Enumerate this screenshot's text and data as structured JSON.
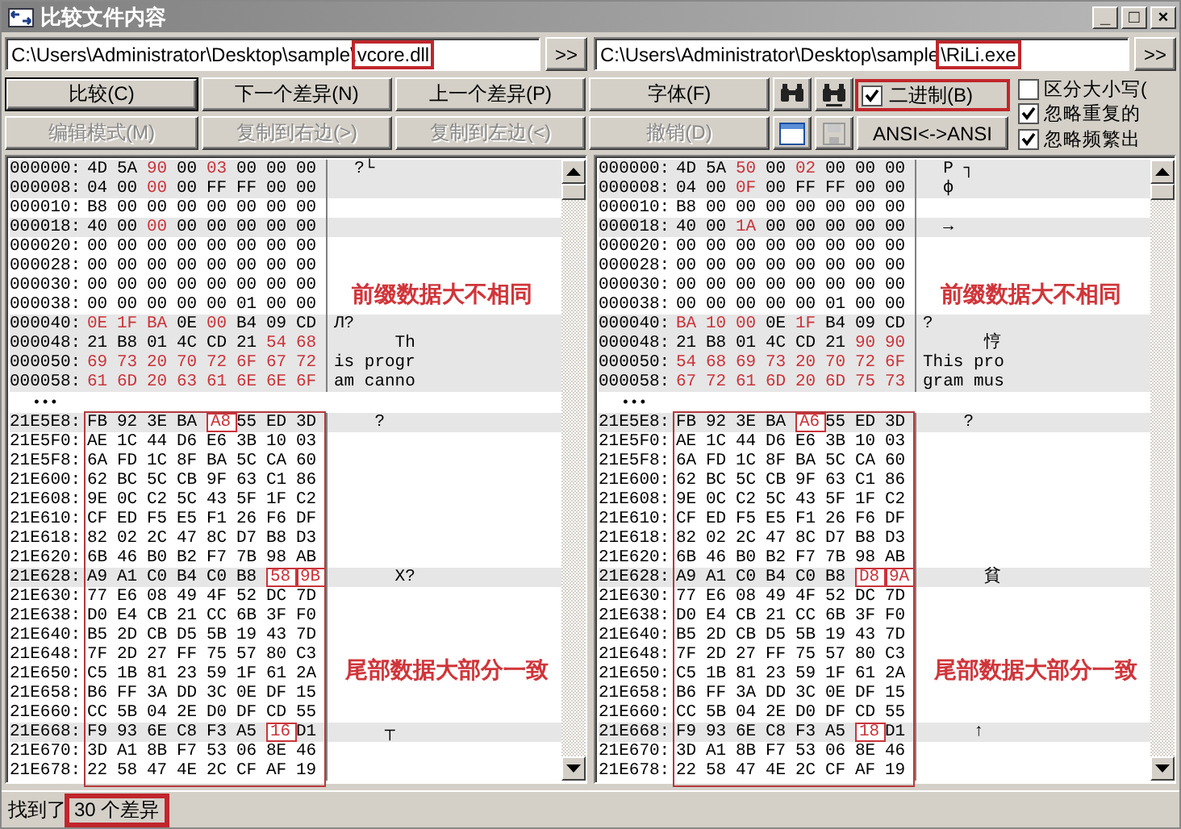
{
  "window": {
    "title": "比较文件内容",
    "controls": [
      "_",
      "□",
      "×"
    ]
  },
  "panes": [
    {
      "path": {
        "prefix": "C:\\Users\\Administrator\\Desktop\\sample\\",
        "file": "vcore.dll",
        "highlighted": true
      },
      "browse_button": ">>",
      "head_rows": [
        {
          "addr": "000000:",
          "bytes": [
            "4D",
            "5A",
            "90",
            "00",
            "03",
            "00",
            "00",
            "00"
          ],
          "diff": [
            false,
            false,
            true,
            false,
            true,
            false,
            false,
            false
          ],
          "ascii": "  ?└"
        },
        {
          "addr": "000008:",
          "bytes": [
            "04",
            "00",
            "00",
            "00",
            "FF",
            "FF",
            "00",
            "00"
          ],
          "diff": [
            false,
            false,
            true,
            false,
            false,
            false,
            false,
            false
          ],
          "ascii": ""
        },
        {
          "addr": "000010:",
          "bytes": [
            "B8",
            "00",
            "00",
            "00",
            "00",
            "00",
            "00",
            "00"
          ],
          "diff": [
            false,
            false,
            false,
            false,
            false,
            false,
            false,
            false
          ],
          "ascii": ""
        },
        {
          "addr": "000018:",
          "bytes": [
            "40",
            "00",
            "00",
            "00",
            "00",
            "00",
            "00",
            "00"
          ],
          "diff": [
            false,
            false,
            true,
            false,
            false,
            false,
            false,
            false
          ],
          "ascii": ""
        },
        {
          "addr": "000020:",
          "bytes": [
            "00",
            "00",
            "00",
            "00",
            "00",
            "00",
            "00",
            "00"
          ],
          "diff": [
            false,
            false,
            false,
            false,
            false,
            false,
            false,
            false
          ],
          "ascii": ""
        },
        {
          "addr": "000028:",
          "bytes": [
            "00",
            "00",
            "00",
            "00",
            "00",
            "00",
            "00",
            "00"
          ],
          "diff": [
            false,
            false,
            false,
            false,
            false,
            false,
            false,
            false
          ],
          "ascii": ""
        },
        {
          "addr": "000030:",
          "bytes": [
            "00",
            "00",
            "00",
            "00",
            "00",
            "00",
            "00",
            "00"
          ],
          "diff": [
            false,
            false,
            false,
            false,
            false,
            false,
            false,
            false
          ],
          "ascii": ""
        },
        {
          "addr": "000038:",
          "bytes": [
            "00",
            "00",
            "00",
            "00",
            "00",
            "01",
            "00",
            "00"
          ],
          "diff": [
            false,
            false,
            false,
            false,
            false,
            false,
            false,
            false
          ],
          "ascii": ""
        },
        {
          "addr": "000040:",
          "bytes": [
            "0E",
            "1F",
            "BA",
            "0E",
            "00",
            "B4",
            "09",
            "CD"
          ],
          "diff": [
            true,
            true,
            true,
            false,
            true,
            false,
            false,
            false
          ],
          "ascii": "Л?"
        },
        {
          "addr": "000048:",
          "bytes": [
            "21",
            "B8",
            "01",
            "4C",
            "CD",
            "21",
            "54",
            "68"
          ],
          "diff": [
            false,
            false,
            false,
            false,
            false,
            false,
            true,
            true
          ],
          "ascii": "      Th"
        },
        {
          "addr": "000050:",
          "bytes": [
            "69",
            "73",
            "20",
            "70",
            "72",
            "6F",
            "67",
            "72"
          ],
          "diff": [
            true,
            true,
            true,
            true,
            true,
            true,
            true,
            true
          ],
          "ascii": "is progr"
        },
        {
          "addr": "000058:",
          "bytes": [
            "61",
            "6D",
            "20",
            "63",
            "61",
            "6E",
            "6E",
            "6F"
          ],
          "diff": [
            true,
            true,
            true,
            true,
            true,
            true,
            true,
            true
          ],
          "ascii": "am canno"
        }
      ],
      "head_note": "前缀数据大不相同",
      "ellipsis": "•••",
      "tail_rows": [
        {
          "addr": "21E5E8:",
          "bytes": [
            "FB",
            "92",
            "3E",
            "BA",
            "A8",
            "55",
            "ED",
            "3D"
          ],
          "diff": [
            false,
            false,
            false,
            false,
            true,
            false,
            false,
            false
          ],
          "ascii": "    ?"
        },
        {
          "addr": "21E5F0:",
          "bytes": [
            "AE",
            "1C",
            "44",
            "D6",
            "E6",
            "3B",
            "10",
            "03"
          ],
          "diff": [
            false,
            false,
            false,
            false,
            false,
            false,
            false,
            false
          ],
          "ascii": ""
        },
        {
          "addr": "21E5F8:",
          "bytes": [
            "6A",
            "FD",
            "1C",
            "8F",
            "BA",
            "5C",
            "CA",
            "60"
          ],
          "diff": [
            false,
            false,
            false,
            false,
            false,
            false,
            false,
            false
          ],
          "ascii": ""
        },
        {
          "addr": "21E600:",
          "bytes": [
            "62",
            "BC",
            "5C",
            "CB",
            "9F",
            "63",
            "C1",
            "86"
          ],
          "diff": [
            false,
            false,
            false,
            false,
            false,
            false,
            false,
            false
          ],
          "ascii": ""
        },
        {
          "addr": "21E608:",
          "bytes": [
            "9E",
            "0C",
            "C2",
            "5C",
            "43",
            "5F",
            "1F",
            "C2"
          ],
          "diff": [
            false,
            false,
            false,
            false,
            false,
            false,
            false,
            false
          ],
          "ascii": ""
        },
        {
          "addr": "21E610:",
          "bytes": [
            "CF",
            "ED",
            "F5",
            "E5",
            "F1",
            "26",
            "F6",
            "DF"
          ],
          "diff": [
            false,
            false,
            false,
            false,
            false,
            false,
            false,
            false
          ],
          "ascii": ""
        },
        {
          "addr": "21E618:",
          "bytes": [
            "82",
            "02",
            "2C",
            "47",
            "8C",
            "D7",
            "B8",
            "D3"
          ],
          "diff": [
            false,
            false,
            false,
            false,
            false,
            false,
            false,
            false
          ],
          "ascii": ""
        },
        {
          "addr": "21E620:",
          "bytes": [
            "6B",
            "46",
            "B0",
            "B2",
            "F7",
            "7B",
            "98",
            "AB"
          ],
          "diff": [
            false,
            false,
            false,
            false,
            false,
            false,
            false,
            false
          ],
          "ascii": ""
        },
        {
          "addr": "21E628:",
          "bytes": [
            "A9",
            "A1",
            "C0",
            "B4",
            "C0",
            "B8",
            "58",
            "9B"
          ],
          "diff": [
            false,
            false,
            false,
            false,
            false,
            false,
            true,
            true
          ],
          "ascii": "      X?"
        },
        {
          "addr": "21E630:",
          "bytes": [
            "77",
            "E6",
            "08",
            "49",
            "4F",
            "52",
            "DC",
            "7D"
          ],
          "diff": [
            false,
            false,
            false,
            false,
            false,
            false,
            false,
            false
          ],
          "ascii": ""
        },
        {
          "addr": "21E638:",
          "bytes": [
            "D0",
            "E4",
            "CB",
            "21",
            "CC",
            "6B",
            "3F",
            "F0"
          ],
          "diff": [
            false,
            false,
            false,
            false,
            false,
            false,
            false,
            false
          ],
          "ascii": ""
        },
        {
          "addr": "21E640:",
          "bytes": [
            "B5",
            "2D",
            "CB",
            "D5",
            "5B",
            "19",
            "43",
            "7D"
          ],
          "diff": [
            false,
            false,
            false,
            false,
            false,
            false,
            false,
            false
          ],
          "ascii": ""
        },
        {
          "addr": "21E648:",
          "bytes": [
            "7F",
            "2D",
            "27",
            "FF",
            "75",
            "57",
            "80",
            "C3"
          ],
          "diff": [
            false,
            false,
            false,
            false,
            false,
            false,
            false,
            false
          ],
          "ascii": ""
        },
        {
          "addr": "21E650:",
          "bytes": [
            "C5",
            "1B",
            "81",
            "23",
            "59",
            "1F",
            "61",
            "2A"
          ],
          "diff": [
            false,
            false,
            false,
            false,
            false,
            false,
            false,
            false
          ],
          "ascii": ""
        },
        {
          "addr": "21E658:",
          "bytes": [
            "B6",
            "FF",
            "3A",
            "DD",
            "3C",
            "0E",
            "DF",
            "15"
          ],
          "diff": [
            false,
            false,
            false,
            false,
            false,
            false,
            false,
            false
          ],
          "ascii": ""
        },
        {
          "addr": "21E660:",
          "bytes": [
            "CC",
            "5B",
            "04",
            "2E",
            "D0",
            "DF",
            "CD",
            "55"
          ],
          "diff": [
            false,
            false,
            false,
            false,
            false,
            false,
            false,
            false
          ],
          "ascii": ""
        },
        {
          "addr": "21E668:",
          "bytes": [
            "F9",
            "93",
            "6E",
            "C8",
            "F3",
            "A5",
            "16",
            "D1"
          ],
          "diff": [
            false,
            false,
            false,
            false,
            false,
            false,
            true,
            false
          ],
          "ascii": "     ┬"
        },
        {
          "addr": "21E670:",
          "bytes": [
            "3D",
            "A1",
            "8B",
            "F7",
            "53",
            "06",
            "8E",
            "46"
          ],
          "diff": [
            false,
            false,
            false,
            false,
            false,
            false,
            false,
            false
          ],
          "ascii": ""
        },
        {
          "addr": "21E678:",
          "bytes": [
            "22",
            "58",
            "47",
            "4E",
            "2C",
            "CF",
            "AF",
            "19"
          ],
          "diff": [
            false,
            false,
            false,
            false,
            false,
            false,
            false,
            false
          ],
          "ascii": ""
        }
      ],
      "tail_note": "尾部数据大部分一致",
      "tail_framed": true
    },
    {
      "path": {
        "prefix": "C:\\Users\\Administrator\\Desktop\\sample",
        "file": "\\RiLi.exe",
        "highlighted": true
      },
      "browse_button": ">>",
      "head_rows": [
        {
          "addr": "000000:",
          "bytes": [
            "4D",
            "5A",
            "50",
            "00",
            "02",
            "00",
            "00",
            "00"
          ],
          "diff": [
            false,
            false,
            true,
            false,
            true,
            false,
            false,
            false
          ],
          "ascii": "  P ┐"
        },
        {
          "addr": "000008:",
          "bytes": [
            "04",
            "00",
            "0F",
            "00",
            "FF",
            "FF",
            "00",
            "00"
          ],
          "diff": [
            false,
            false,
            true,
            false,
            false,
            false,
            false,
            false
          ],
          "ascii": "  ф"
        },
        {
          "addr": "000010:",
          "bytes": [
            "B8",
            "00",
            "00",
            "00",
            "00",
            "00",
            "00",
            "00"
          ],
          "diff": [
            false,
            false,
            false,
            false,
            false,
            false,
            false,
            false
          ],
          "ascii": ""
        },
        {
          "addr": "000018:",
          "bytes": [
            "40",
            "00",
            "1A",
            "00",
            "00",
            "00",
            "00",
            "00"
          ],
          "diff": [
            false,
            false,
            true,
            false,
            false,
            false,
            false,
            false
          ],
          "ascii": "  →"
        },
        {
          "addr": "000020:",
          "bytes": [
            "00",
            "00",
            "00",
            "00",
            "00",
            "00",
            "00",
            "00"
          ],
          "diff": [
            false,
            false,
            false,
            false,
            false,
            false,
            false,
            false
          ],
          "ascii": ""
        },
        {
          "addr": "000028:",
          "bytes": [
            "00",
            "00",
            "00",
            "00",
            "00",
            "00",
            "00",
            "00"
          ],
          "diff": [
            false,
            false,
            false,
            false,
            false,
            false,
            false,
            false
          ],
          "ascii": ""
        },
        {
          "addr": "000030:",
          "bytes": [
            "00",
            "00",
            "00",
            "00",
            "00",
            "00",
            "00",
            "00"
          ],
          "diff": [
            false,
            false,
            false,
            false,
            false,
            false,
            false,
            false
          ],
          "ascii": ""
        },
        {
          "addr": "000038:",
          "bytes": [
            "00",
            "00",
            "00",
            "00",
            "00",
            "01",
            "00",
            "00"
          ],
          "diff": [
            false,
            false,
            false,
            false,
            false,
            false,
            false,
            false
          ],
          "ascii": ""
        },
        {
          "addr": "000040:",
          "bytes": [
            "BA",
            "10",
            "00",
            "0E",
            "1F",
            "B4",
            "09",
            "CD"
          ],
          "diff": [
            true,
            true,
            true,
            false,
            true,
            false,
            false,
            false
          ],
          "ascii": "?"
        },
        {
          "addr": "000048:",
          "bytes": [
            "21",
            "B8",
            "01",
            "4C",
            "CD",
            "21",
            "90",
            "90"
          ],
          "diff": [
            false,
            false,
            false,
            false,
            false,
            false,
            true,
            true
          ],
          "ascii": "      悙"
        },
        {
          "addr": "000050:",
          "bytes": [
            "54",
            "68",
            "69",
            "73",
            "20",
            "70",
            "72",
            "6F"
          ],
          "diff": [
            true,
            true,
            true,
            true,
            true,
            true,
            true,
            true
          ],
          "ascii": "This pro"
        },
        {
          "addr": "000058:",
          "bytes": [
            "67",
            "72",
            "61",
            "6D",
            "20",
            "6D",
            "75",
            "73"
          ],
          "diff": [
            true,
            true,
            true,
            true,
            true,
            true,
            true,
            true
          ],
          "ascii": "gram mus"
        }
      ],
      "head_note": "前缀数据大不相同",
      "ellipsis": "•••",
      "tail_rows": [
        {
          "addr": "21E5E8:",
          "bytes": [
            "FB",
            "92",
            "3E",
            "BA",
            "A6",
            "55",
            "ED",
            "3D"
          ],
          "diff": [
            false,
            false,
            false,
            false,
            true,
            false,
            false,
            false
          ],
          "ascii": "    ?"
        },
        {
          "addr": "21E5F0:",
          "bytes": [
            "AE",
            "1C",
            "44",
            "D6",
            "E6",
            "3B",
            "10",
            "03"
          ],
          "diff": [
            false,
            false,
            false,
            false,
            false,
            false,
            false,
            false
          ],
          "ascii": ""
        },
        {
          "addr": "21E5F8:",
          "bytes": [
            "6A",
            "FD",
            "1C",
            "8F",
            "BA",
            "5C",
            "CA",
            "60"
          ],
          "diff": [
            false,
            false,
            false,
            false,
            false,
            false,
            false,
            false
          ],
          "ascii": ""
        },
        {
          "addr": "21E600:",
          "bytes": [
            "62",
            "BC",
            "5C",
            "CB",
            "9F",
            "63",
            "C1",
            "86"
          ],
          "diff": [
            false,
            false,
            false,
            false,
            false,
            false,
            false,
            false
          ],
          "ascii": ""
        },
        {
          "addr": "21E608:",
          "bytes": [
            "9E",
            "0C",
            "C2",
            "5C",
            "43",
            "5F",
            "1F",
            "C2"
          ],
          "diff": [
            false,
            false,
            false,
            false,
            false,
            false,
            false,
            false
          ],
          "ascii": ""
        },
        {
          "addr": "21E610:",
          "bytes": [
            "CF",
            "ED",
            "F5",
            "E5",
            "F1",
            "26",
            "F6",
            "DF"
          ],
          "diff": [
            false,
            false,
            false,
            false,
            false,
            false,
            false,
            false
          ],
          "ascii": ""
        },
        {
          "addr": "21E618:",
          "bytes": [
            "82",
            "02",
            "2C",
            "47",
            "8C",
            "D7",
            "B8",
            "D3"
          ],
          "diff": [
            false,
            false,
            false,
            false,
            false,
            false,
            false,
            false
          ],
          "ascii": ""
        },
        {
          "addr": "21E620:",
          "bytes": [
            "6B",
            "46",
            "B0",
            "B2",
            "F7",
            "7B",
            "98",
            "AB"
          ],
          "diff": [
            false,
            false,
            false,
            false,
            false,
            false,
            false,
            false
          ],
          "ascii": ""
        },
        {
          "addr": "21E628:",
          "bytes": [
            "A9",
            "A1",
            "C0",
            "B4",
            "C0",
            "B8",
            "D8",
            "9A"
          ],
          "diff": [
            false,
            false,
            false,
            false,
            false,
            false,
            true,
            true
          ],
          "ascii": "      貧"
        },
        {
          "addr": "21E630:",
          "bytes": [
            "77",
            "E6",
            "08",
            "49",
            "4F",
            "52",
            "DC",
            "7D"
          ],
          "diff": [
            false,
            false,
            false,
            false,
            false,
            false,
            false,
            false
          ],
          "ascii": ""
        },
        {
          "addr": "21E638:",
          "bytes": [
            "D0",
            "E4",
            "CB",
            "21",
            "CC",
            "6B",
            "3F",
            "F0"
          ],
          "diff": [
            false,
            false,
            false,
            false,
            false,
            false,
            false,
            false
          ],
          "ascii": ""
        },
        {
          "addr": "21E640:",
          "bytes": [
            "B5",
            "2D",
            "CB",
            "D5",
            "5B",
            "19",
            "43",
            "7D"
          ],
          "diff": [
            false,
            false,
            false,
            false,
            false,
            false,
            false,
            false
          ],
          "ascii": ""
        },
        {
          "addr": "21E648:",
          "bytes": [
            "7F",
            "2D",
            "27",
            "FF",
            "75",
            "57",
            "80",
            "C3"
          ],
          "diff": [
            false,
            false,
            false,
            false,
            false,
            false,
            false,
            false
          ],
          "ascii": ""
        },
        {
          "addr": "21E650:",
          "bytes": [
            "C5",
            "1B",
            "81",
            "23",
            "59",
            "1F",
            "61",
            "2A"
          ],
          "diff": [
            false,
            false,
            false,
            false,
            false,
            false,
            false,
            false
          ],
          "ascii": ""
        },
        {
          "addr": "21E658:",
          "bytes": [
            "B6",
            "FF",
            "3A",
            "DD",
            "3C",
            "0E",
            "DF",
            "15"
          ],
          "diff": [
            false,
            false,
            false,
            false,
            false,
            false,
            false,
            false
          ],
          "ascii": ""
        },
        {
          "addr": "21E660:",
          "bytes": [
            "CC",
            "5B",
            "04",
            "2E",
            "D0",
            "DF",
            "CD",
            "55"
          ],
          "diff": [
            false,
            false,
            false,
            false,
            false,
            false,
            false,
            false
          ],
          "ascii": ""
        },
        {
          "addr": "21E668:",
          "bytes": [
            "F9",
            "93",
            "6E",
            "C8",
            "F3",
            "A5",
            "18",
            "D1"
          ],
          "diff": [
            false,
            false,
            false,
            false,
            false,
            false,
            true,
            false
          ],
          "ascii": "     ↑"
        },
        {
          "addr": "21E670:",
          "bytes": [
            "3D",
            "A1",
            "8B",
            "F7",
            "53",
            "06",
            "8E",
            "46"
          ],
          "diff": [
            false,
            false,
            false,
            false,
            false,
            false,
            false,
            false
          ],
          "ascii": ""
        },
        {
          "addr": "21E678:",
          "bytes": [
            "22",
            "58",
            "47",
            "4E",
            "2C",
            "CF",
            "AF",
            "19"
          ],
          "diff": [
            false,
            false,
            false,
            false,
            false,
            false,
            false,
            false
          ],
          "ascii": ""
        }
      ],
      "tail_note": "尾部数据大部分一致",
      "tail_framed": true
    }
  ],
  "toolbar": {
    "buttons": [
      {
        "label": "比较(C)",
        "default": true,
        "disabled": false
      },
      {
        "label": "下一个差异(N)",
        "default": false,
        "disabled": false
      },
      {
        "label": "上一个差异(P)",
        "default": false,
        "disabled": false
      },
      {
        "label": "字体(F)",
        "default": false,
        "disabled": false
      },
      {
        "label": "编辑模式(M)",
        "default": false,
        "disabled": true
      },
      {
        "label": "复制到右边(>)",
        "default": false,
        "disabled": true
      },
      {
        "label": "复制到左边(<)",
        "default": false,
        "disabled": true
      },
      {
        "label": "撤销(D)",
        "default": false,
        "disabled": true
      }
    ],
    "icon_buttons": [
      {
        "kind": "find",
        "disabled": false
      },
      {
        "kind": "find-next",
        "disabled": false
      },
      {
        "kind": "window",
        "disabled": false
      },
      {
        "kind": "save",
        "disabled": true
      }
    ],
    "binary": {
      "label": "二进制(B)",
      "checked": true,
      "highlighted": true
    },
    "ansi_button": "ANSI<->ANSI",
    "options": [
      {
        "label": "区分大小写(",
        "checked": false
      },
      {
        "label": "忽略重复的",
        "checked": true
      },
      {
        "label": "忽略频繁出",
        "checked": true
      }
    ]
  },
  "status_bar": {
    "prefix": "找到了",
    "count": "30 个差异",
    "highlighted": true
  }
}
